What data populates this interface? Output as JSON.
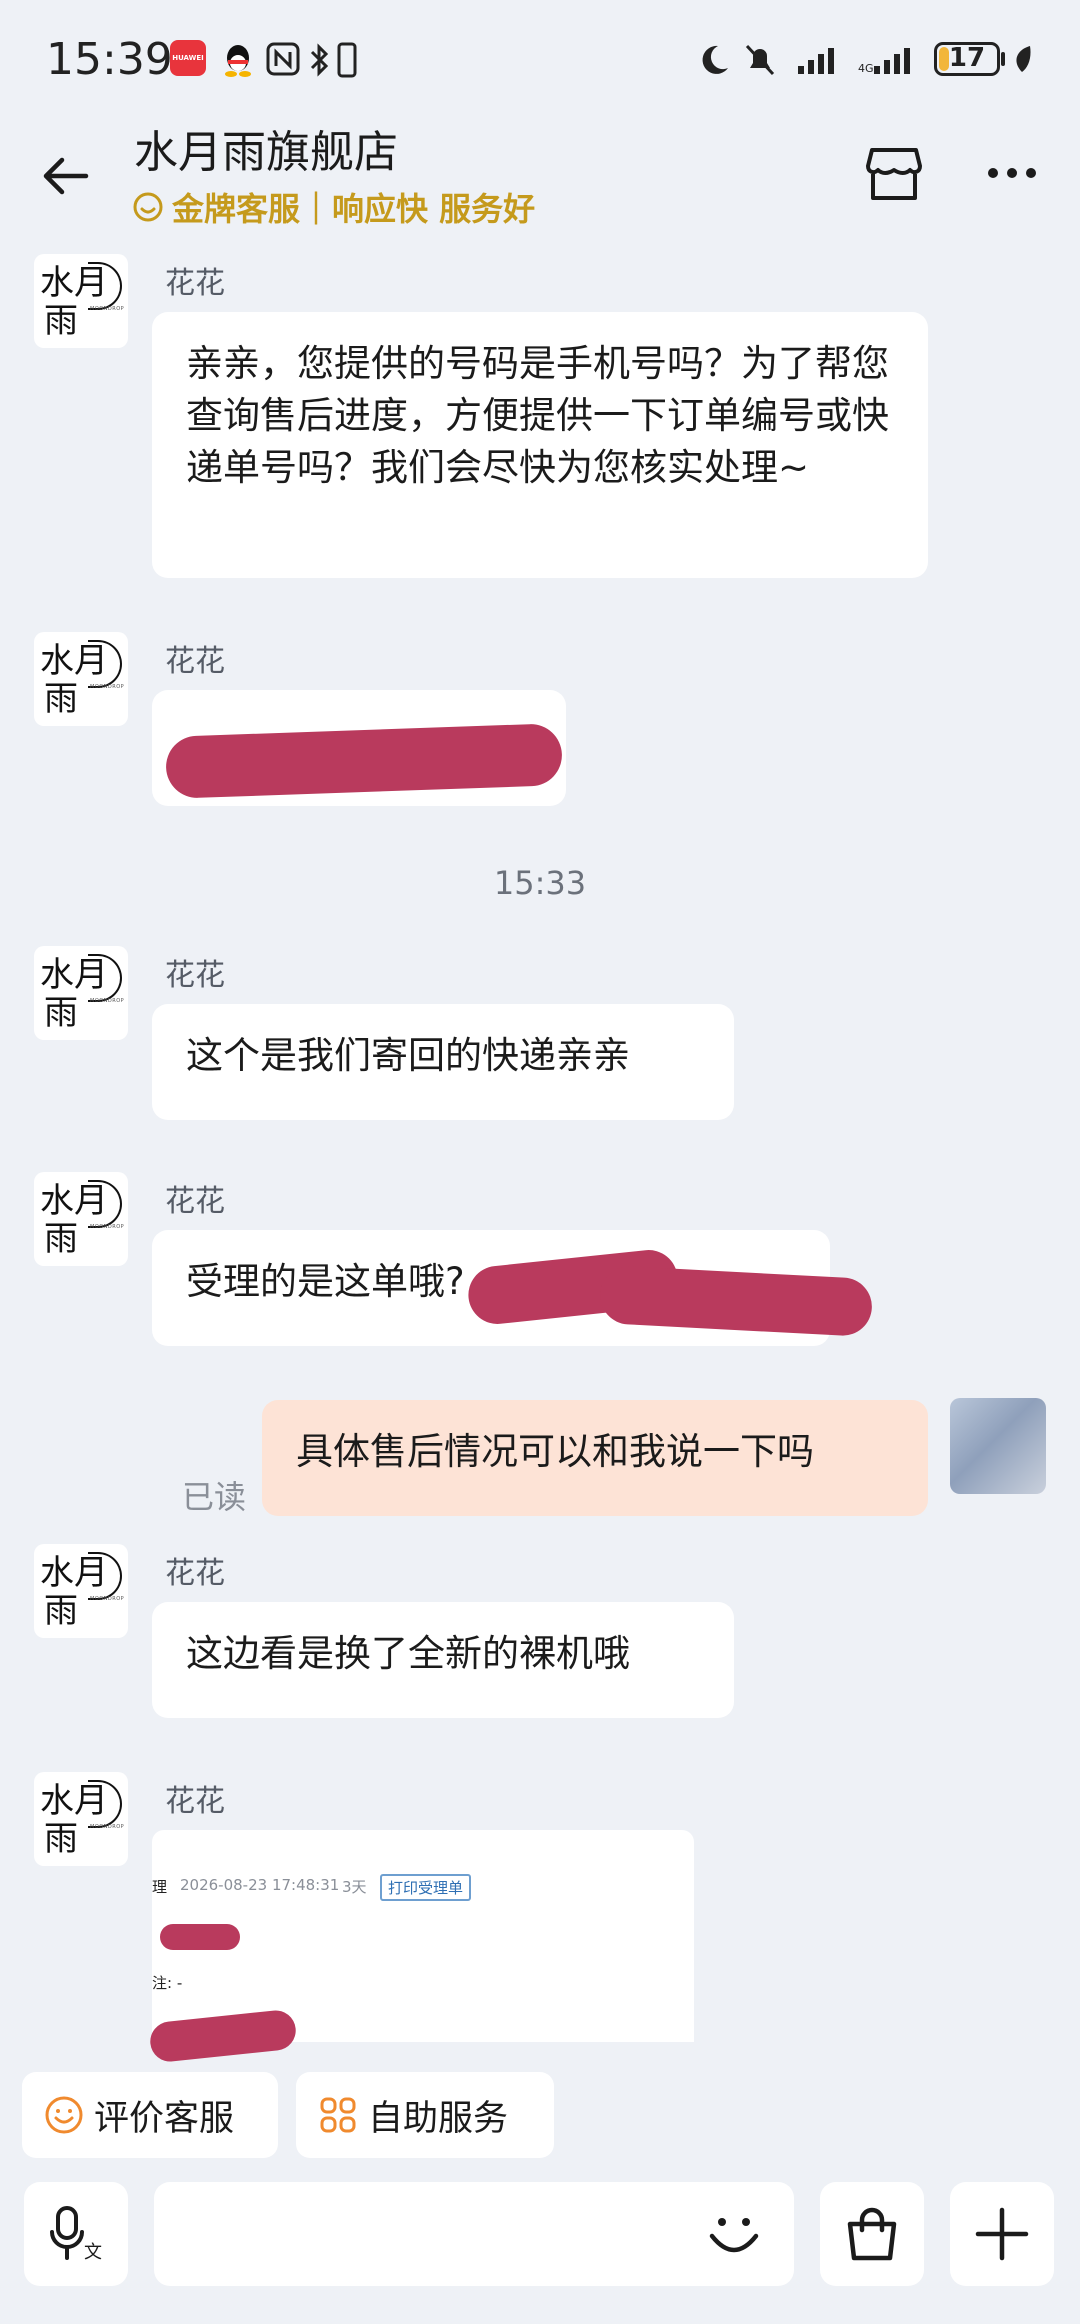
{
  "status_bar": {
    "time": "15:39",
    "battery": "17",
    "battery_level": 0.17,
    "huawei_label": "HUAWEI"
  },
  "header": {
    "shop_name": "水月雨旗舰店",
    "badge": "金牌客服｜响应快 服务好"
  },
  "avatar": {
    "brand_line1": "水月",
    "brand_line2": "雨",
    "brand_small": "MOONDROP"
  },
  "messages": [
    {
      "sender": "花花",
      "text": "亲亲，您提供的号码是手机号吗？为了帮您查询售后进度，方便提供一下订单编号或快递单号吗？我们会尽快为您核实处理~"
    },
    {
      "sender": "花花",
      "text": ""
    },
    {
      "sender": "花花",
      "text": "这个是我们寄回的快递亲亲"
    },
    {
      "sender": "花花",
      "text": "受理的是这单哦?"
    },
    {
      "sender": "花花",
      "text": "这边看是换了全新的裸机哦"
    },
    {
      "sender": "花花",
      "text": ""
    }
  ],
  "time_divider": "15:33",
  "outgoing": {
    "text": "具体售后情况可以和我说一下吗",
    "read_label": "已读"
  },
  "card": {
    "title": "理",
    "date": "2026-08-23 17:48:31",
    "duration": "3天",
    "print_label": "打印受理单",
    "note": "注: -"
  },
  "quick_actions": [
    {
      "label": "评价客服",
      "icon": "smile-icon"
    },
    {
      "label": "自助服务",
      "icon": "grid-icon"
    }
  ],
  "input_bar": {
    "voice_icon": "voice-to-text-icon",
    "emoji_icon": "emoji-icon",
    "bag_icon": "shopping-bag-icon",
    "plus_icon": "plus-icon"
  },
  "colors": {
    "accent_gold": "#c59a1c",
    "outgoing_bubble": "#fde3d6",
    "redaction": "#b93a5d",
    "background": "#eef1f6"
  }
}
